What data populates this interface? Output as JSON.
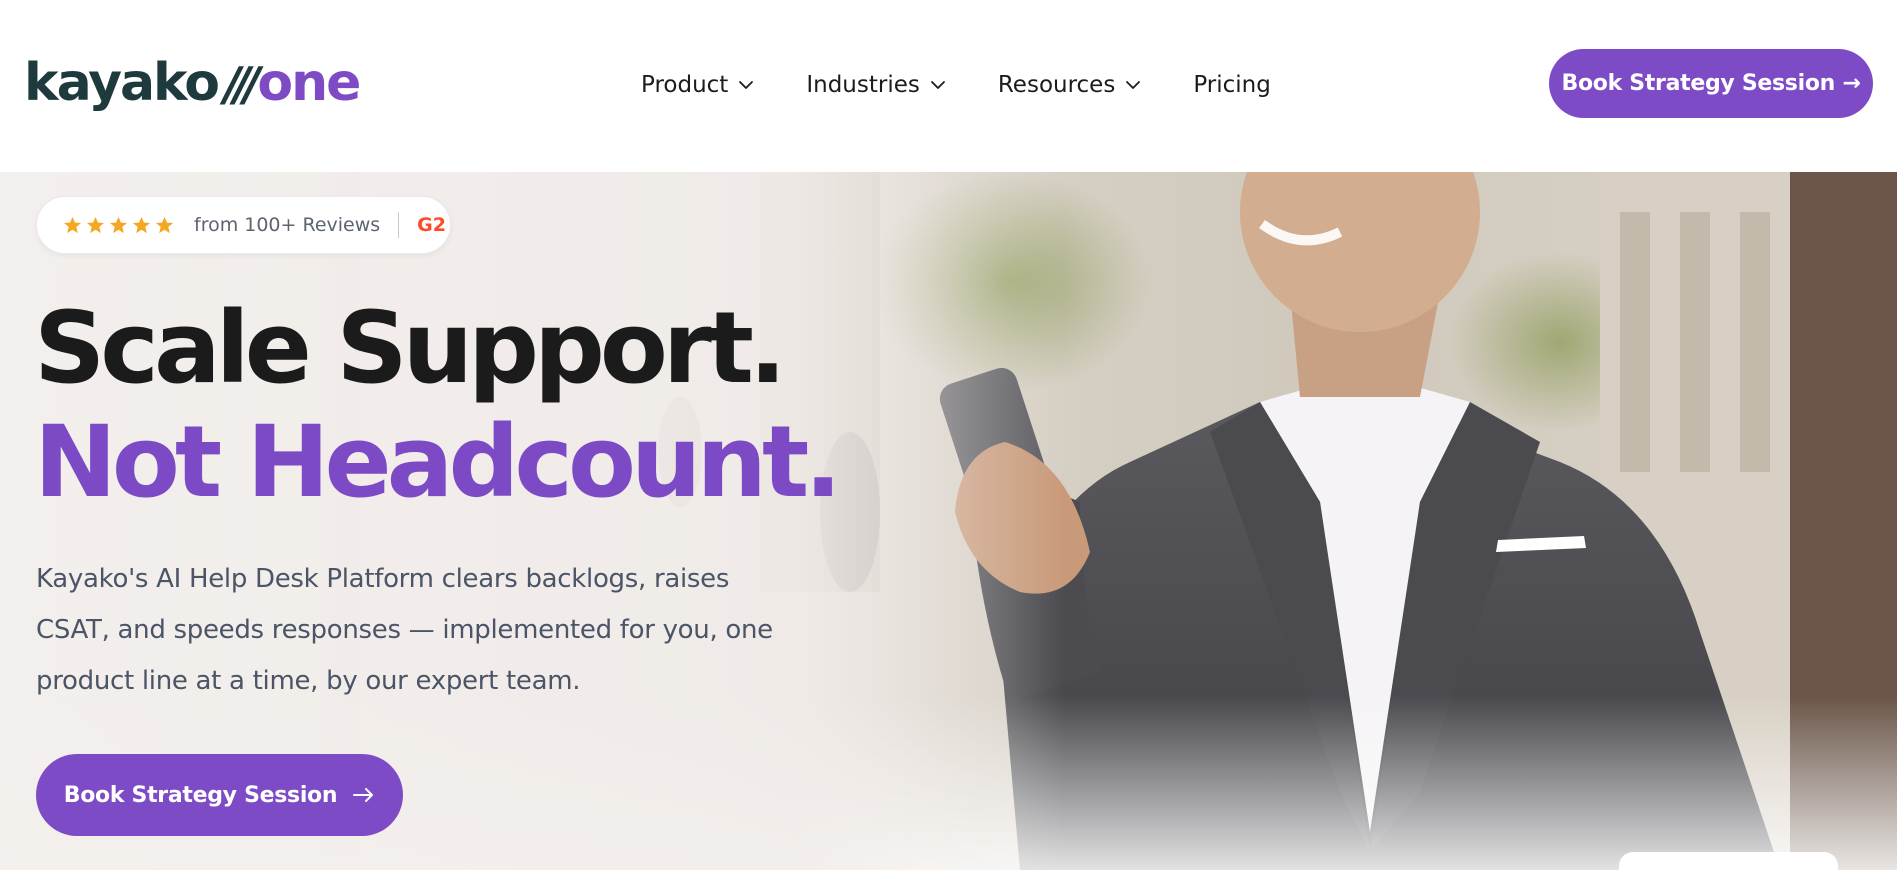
{
  "header": {
    "logo": {
      "word": "kayako",
      "slashes": "///",
      "suffix": "one"
    },
    "nav": [
      {
        "label": "Product",
        "has_dropdown": true
      },
      {
        "label": "Industries",
        "has_dropdown": true
      },
      {
        "label": "Resources",
        "has_dropdown": true
      },
      {
        "label": "Pricing",
        "has_dropdown": false
      }
    ],
    "cta_label": "Book Strategy Session →"
  },
  "hero": {
    "rating": {
      "stars": 5,
      "text": "from 100+ Reviews",
      "source": "G2"
    },
    "headline_line1": "Scale Support.",
    "headline_line2": "Not Headcount.",
    "subtext": "Kayako's AI Help Desk Platform clears backlogs, raises CSAT, and speeds responses — implemented for you, one product line at a time, by our expert team.",
    "cta_label": "Book Strategy Session",
    "cta_icon": "arrow-right-icon"
  },
  "colors": {
    "brand_purple": "#7e4bc7",
    "logo_dark": "#1f3a3d",
    "star_orange": "#f5a623",
    "g2_red": "#ff492c",
    "text_dark": "#1b1b1b",
    "text_body": "#4b5567"
  }
}
